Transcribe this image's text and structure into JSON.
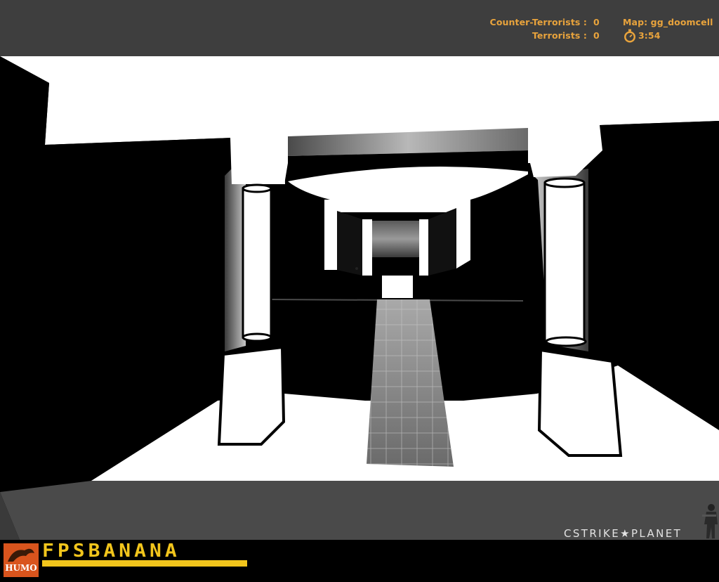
{
  "hud": {
    "ct_label": "Counter-Terrorists :",
    "ct_score": "0",
    "t_label": "Terrorists :",
    "t_score": "0",
    "map_label": "Map: gg_doomcell",
    "timer": "3:54",
    "timer_icon": "stopwatch-icon",
    "text_color": "#e8a33c",
    "bar_color": "#3e3e3e"
  },
  "watermarks": {
    "cstrike": "CSTRIKE★PLANET",
    "fpsbanana": "FPSBANANA",
    "humo": "HUMO",
    "fps_color": "#f2c51c",
    "humo_color": "#d9541d"
  },
  "scene": {
    "description_icons": [
      "pillar-left",
      "pillar-right",
      "tiled-walkway",
      "archway",
      "skybox-window"
    ]
  }
}
